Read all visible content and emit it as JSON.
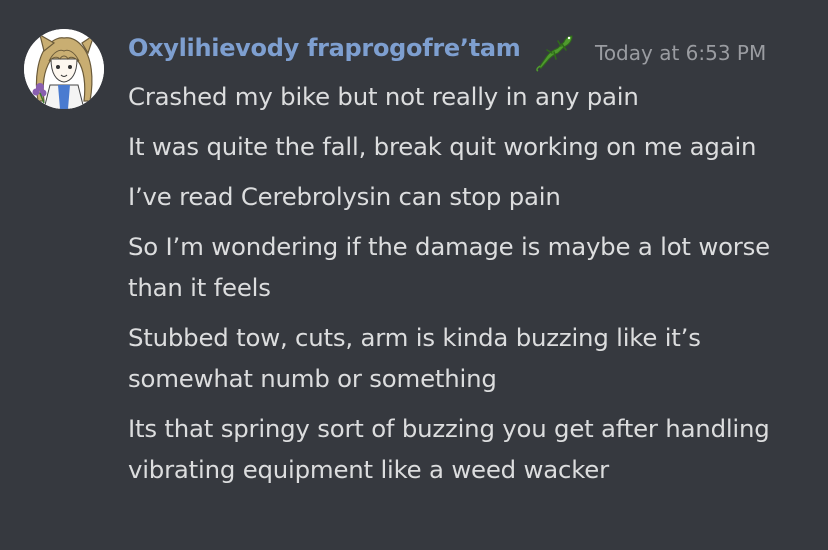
{
  "message_group": {
    "author": {
      "name": "Oxylihievody fraprogofre’tam",
      "badge_icon": "lizard-icon"
    },
    "timestamp": "Today at 6:53 PM",
    "messages": [
      "Crashed my bike but not really in any pain",
      "It was quite the fall, break quit working on me again",
      "I’ve read Cerebrolysin can stop pain",
      "So I’m wondering if the damage is maybe a lot worse than it feels",
      "Stubbed tow, cuts, arm is kinda buzzing like it’s somewhat numb or something",
      "Its that springy sort of buzzing you get after handling vibrating equipment like a weed wacker"
    ]
  },
  "colors": {
    "background": "#36393f",
    "username": "#7e9fd0",
    "message_text": "#dcddde",
    "timestamp": "#9a9ca1",
    "badge": "#4f9a2e"
  }
}
